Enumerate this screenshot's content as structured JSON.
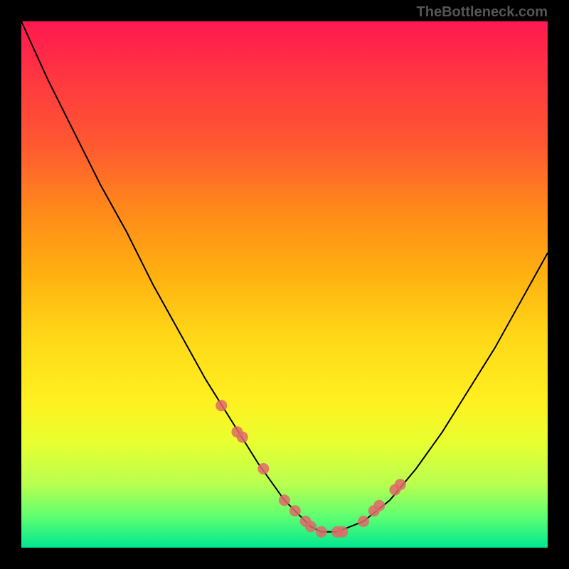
{
  "watermark": "TheBottleneck.com",
  "chart_data": {
    "type": "line",
    "title": "",
    "xlabel": "",
    "ylabel": "",
    "xlim": [
      0,
      100
    ],
    "ylim": [
      0,
      100
    ],
    "series": [
      {
        "name": "curve",
        "x": [
          0,
          5,
          10,
          15,
          20,
          25,
          30,
          35,
          40,
          45,
          50,
          55,
          57,
          60,
          65,
          70,
          75,
          80,
          85,
          90,
          95,
          100
        ],
        "values": [
          100,
          89,
          79,
          69,
          60,
          50,
          41,
          32,
          24,
          16,
          9,
          4,
          3,
          3,
          5,
          9,
          15,
          22,
          30,
          38,
          47,
          56
        ]
      }
    ],
    "highlighted_points": {
      "x": [
        38,
        41,
        42,
        46,
        50,
        52,
        54,
        55,
        57,
        60,
        61,
        65,
        67,
        68,
        71,
        72
      ],
      "y": [
        27,
        22,
        21,
        15,
        9,
        7,
        5,
        4,
        3,
        3,
        3,
        5,
        7,
        8,
        11,
        12
      ]
    }
  }
}
